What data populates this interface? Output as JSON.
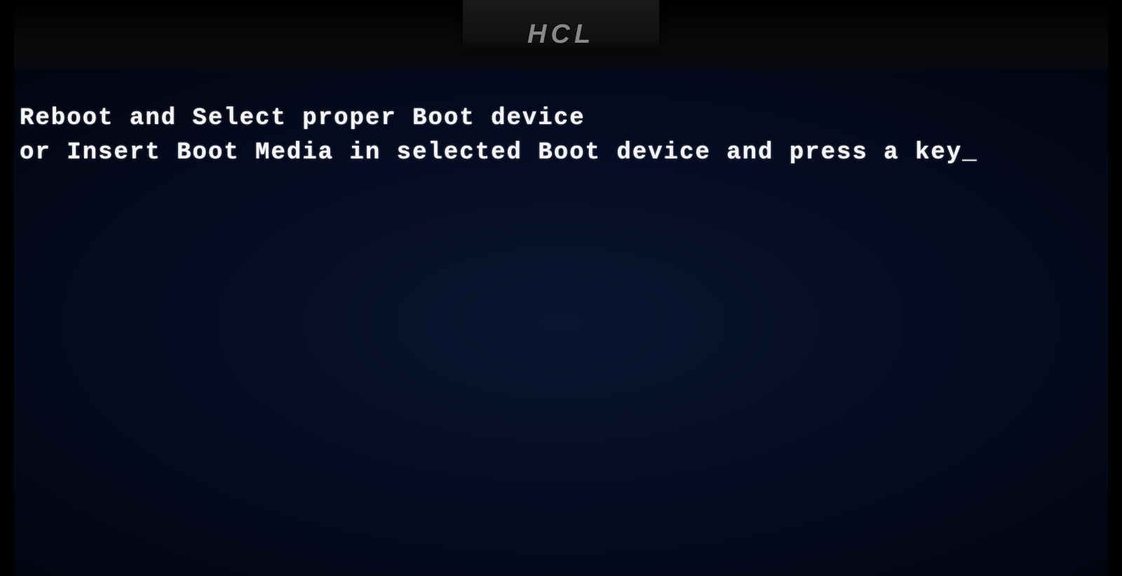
{
  "monitor": {
    "brand": "HCL"
  },
  "bios": {
    "line1": "Reboot and Select proper Boot device",
    "line2": "or Insert Boot Media in selected Boot device and press a key",
    "cursor": "_"
  }
}
